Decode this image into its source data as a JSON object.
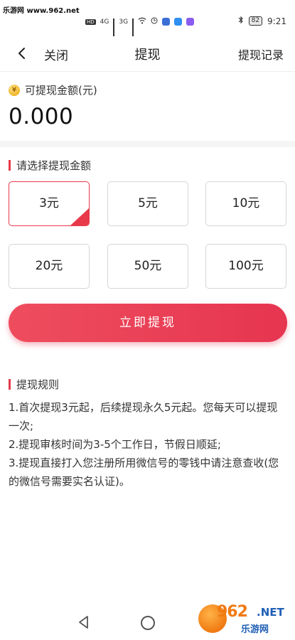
{
  "watermark": {
    "top_text": "乐游网 www.962.net",
    "logo_number": "962",
    "logo_dot_net": ".NET",
    "logo_cn": "乐游网"
  },
  "status_bar": {
    "signal_1": "4G",
    "signal_2": "3G",
    "battery": "82",
    "time": "9:21",
    "hd_label": "HD"
  },
  "header": {
    "close_label": "关闭",
    "title": "提现",
    "records_label": "提现记录"
  },
  "balance": {
    "label": "可提现金额(元)",
    "amount": "0.000"
  },
  "amount_section": {
    "label": "请选择提现金额",
    "options": [
      "3元",
      "5元",
      "10元",
      "20元",
      "50元",
      "100元"
    ],
    "selected_index": 0
  },
  "withdraw_button": {
    "label": "立即提现"
  },
  "rules": {
    "title": "提现规则",
    "lines": [
      "1.首次提现3元起，后续提现永久5元起。您每天可以提现一次;",
      "2.提现审核时间为3-5个工作日，节假日顺延;",
      "3.提现直接打入您注册所用微信号的零钱中请注意查收(您的微信号需要实名认证)。"
    ]
  },
  "colors": {
    "accent": "#e8394a",
    "button_gradient_start": "#ee4d5e",
    "button_gradient_end": "#e63550",
    "coin": "#f0b429"
  }
}
